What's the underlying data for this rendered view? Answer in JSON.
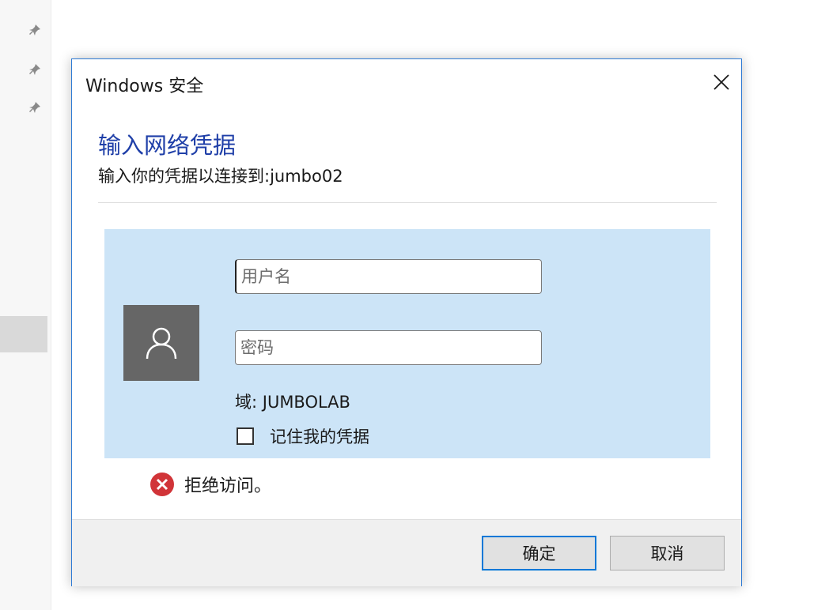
{
  "dialog": {
    "title": "Windows 安全",
    "heading": "输入网络凭据",
    "subheading": "输入你的凭据以连接到:jumbo02",
    "username_placeholder": "用户名",
    "username_value": "",
    "password_placeholder": "密码",
    "password_value": "",
    "domain": "域: JUMBOLAB",
    "remember_label": "记住我的凭据",
    "remember_checked": false,
    "error_message": "拒绝访问。",
    "ok_label": "确定",
    "cancel_label": "取消"
  },
  "icons": {
    "close": "close-icon",
    "avatar": "user-icon",
    "error": "error-icon",
    "pins": [
      "pin-icon",
      "pin-icon",
      "pin-icon"
    ]
  },
  "colors": {
    "accent": "#0078d7",
    "heading": "#1f3fa8",
    "panel": "#cce4f7",
    "error": "#d13438"
  }
}
